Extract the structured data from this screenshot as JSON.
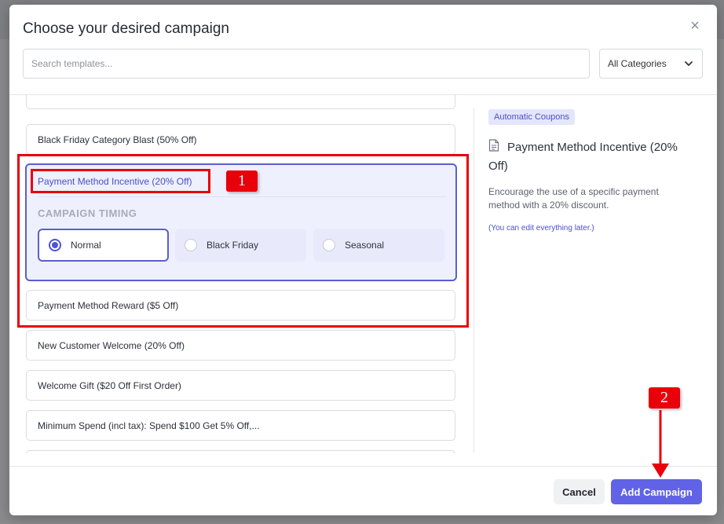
{
  "modal": {
    "title": "Choose your desired campaign",
    "close_icon": "close-icon",
    "search": {
      "placeholder": "Search templates...",
      "value": ""
    },
    "category": {
      "selected": "All Categories",
      "icon": "chevron-down-icon"
    }
  },
  "templates": [
    {
      "label": "Black Friday Category Blast (50% Off)"
    },
    {
      "label": "Payment Method Incentive (20% Off)",
      "selected": true
    },
    {
      "label": "Payment Method Reward ($5 Off)"
    },
    {
      "label": "New Customer Welcome (20% Off)"
    },
    {
      "label": "Welcome Gift ($20 Off First Order)"
    },
    {
      "label": "Minimum Spend (incl tax): Spend $100 Get 5% Off,..."
    }
  ],
  "timing": {
    "label": "CAMPAIGN TIMING",
    "options": [
      {
        "label": "Normal",
        "checked": true
      },
      {
        "label": "Black Friday",
        "checked": false
      },
      {
        "label": "Seasonal",
        "checked": false
      }
    ]
  },
  "detail": {
    "tag": "Automatic Coupons",
    "icon": "document-icon",
    "title": "Payment Method Incentive (20% Off)",
    "description": "Encourage the use of a specific payment method with a 20% discount.",
    "note": "(You can edit everything later.)"
  },
  "footer": {
    "cancel_label": "Cancel",
    "add_label": "Add Campaign"
  },
  "annotations": {
    "badge_1": "1",
    "badge_2": "2",
    "color": "#e8000b"
  },
  "colors": {
    "accent": "#6063e6",
    "selected_bg": "#eef0fd"
  }
}
